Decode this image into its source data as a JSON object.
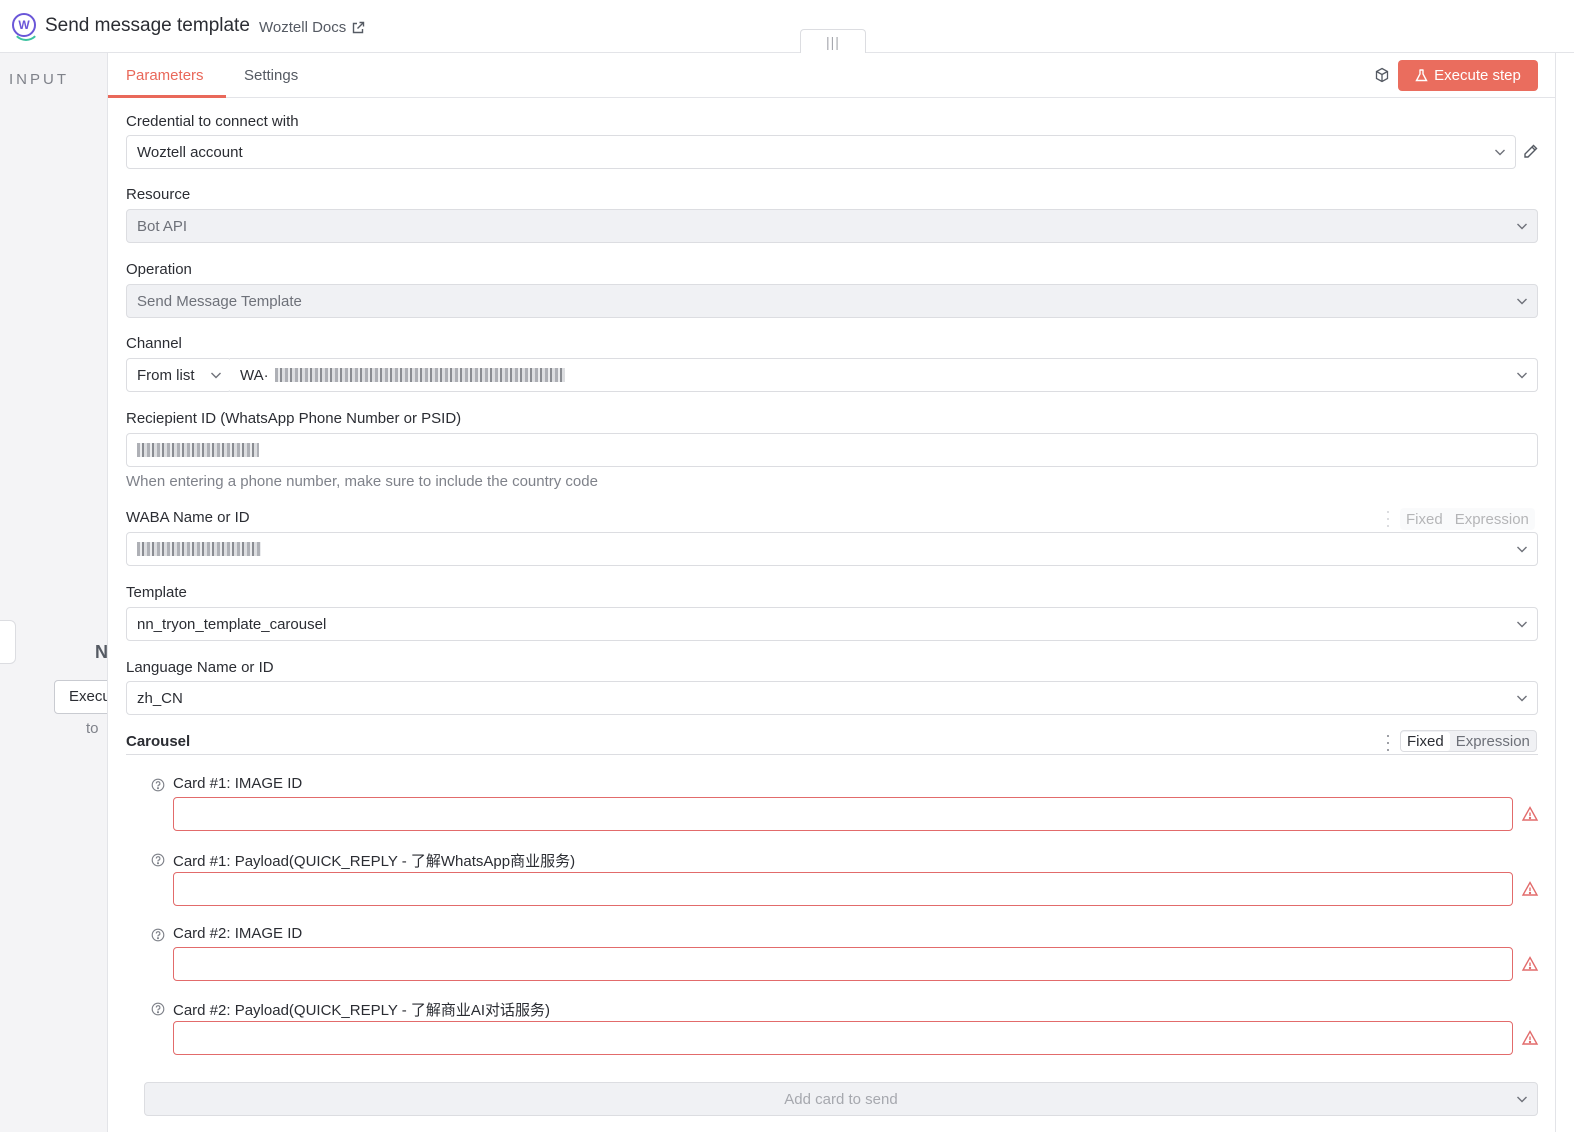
{
  "header": {
    "title": "Send message template",
    "docs_link": "Woztell Docs"
  },
  "input_panel": {
    "label": "INPUT",
    "partial_heading": "N",
    "execute_button": "Execu",
    "partial_text": "to"
  },
  "tabs": [
    {
      "label": "Parameters",
      "active": true
    },
    {
      "label": "Settings",
      "active": false
    }
  ],
  "execute_step_label": "Execute step",
  "colors": {
    "accent": "#ea6d5e",
    "error": "#e26b6b",
    "disabled_bg": "#f0f1f4"
  },
  "form": {
    "credential": {
      "label": "Credential to connect with",
      "value": "Woztell account"
    },
    "resource": {
      "label": "Resource",
      "value": "Bot API"
    },
    "operation": {
      "label": "Operation",
      "value": "Send Message Template"
    },
    "channel": {
      "label": "Channel",
      "mode": "From list",
      "value_prefix": "WA·"
    },
    "recipient": {
      "label": "Reciepient ID (WhatsApp Phone Number or PSID)",
      "hint": "When entering a phone number, make sure to include the country code"
    },
    "waba": {
      "label": "WABA Name or ID",
      "toggle_fixed": "Fixed",
      "toggle_expression": "Expression"
    },
    "template": {
      "label": "Template",
      "value": "nn_tryon_template_carousel"
    },
    "language": {
      "label": "Language Name or ID",
      "value": "zh_CN"
    },
    "carousel": {
      "label": "Carousel",
      "toggle_fixed": "Fixed",
      "toggle_expression": "Expression",
      "cards": [
        {
          "label": "Card #1: IMAGE ID",
          "value": ""
        },
        {
          "label": "Card #1: Payload(QUICK_REPLY - 了解WhatsApp商业服务)",
          "value": ""
        },
        {
          "label": "Card #2: IMAGE ID",
          "value": ""
        },
        {
          "label": "Card #2: Payload(QUICK_REPLY - 了解商业AI对话服务)",
          "value": ""
        }
      ],
      "add_card_placeholder": "Add card to send"
    }
  }
}
